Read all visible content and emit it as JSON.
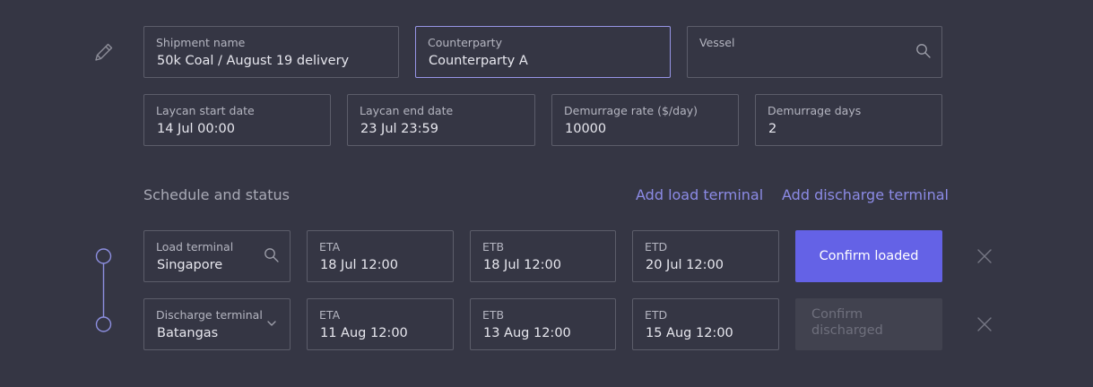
{
  "shipment": {
    "name_label": "Shipment name",
    "name_value": "50k Coal / August 19 delivery",
    "counterparty_label": "Counterparty",
    "counterparty_value": "Counterparty A",
    "vessel_label": "Vessel",
    "vessel_value": ""
  },
  "laycan": {
    "start_label": "Laycan start date",
    "start_value": "14 Jul 00:00",
    "end_label": "Laycan end date",
    "end_value": "23 Jul 23:59",
    "rate_label": "Demurrage rate ($/day)",
    "rate_value": "10000",
    "days_label": "Demurrage days",
    "days_value": "2"
  },
  "schedule": {
    "title": "Schedule and status",
    "add_load": "Add load terminal",
    "add_discharge": "Add discharge terminal",
    "load": {
      "terminal_label": "Load terminal",
      "terminal_value": "Singapore",
      "eta_label": "ETA",
      "eta_value": "18 Jul 12:00",
      "etb_label": "ETB",
      "etb_value": "18 Jul 12:00",
      "etd_label": "ETD",
      "etd_value": "20 Jul 12:00",
      "action_label": "Confirm loaded"
    },
    "discharge": {
      "terminal_label": "Discharge terminal",
      "terminal_value": "Batangas",
      "eta_label": "ETA",
      "eta_value": "11 Aug 12:00",
      "etb_label": "ETB",
      "etb_value": "13 Aug 12:00",
      "etd_label": "ETD",
      "etd_value": "15 Aug 12:00",
      "action_label_line1": "Confirm",
      "action_label_line2": "discharged"
    }
  },
  "colors": {
    "background": "#353644",
    "accent": "#6462e6",
    "link": "#8c8be6",
    "border": "#5c5d6a",
    "focus_border": "#9795e6"
  },
  "icons": {
    "edit": "pencil-icon",
    "search": "search-icon",
    "dropdown": "chevron-down-icon",
    "remove": "close-icon",
    "timeline": "timeline-node-icon"
  }
}
